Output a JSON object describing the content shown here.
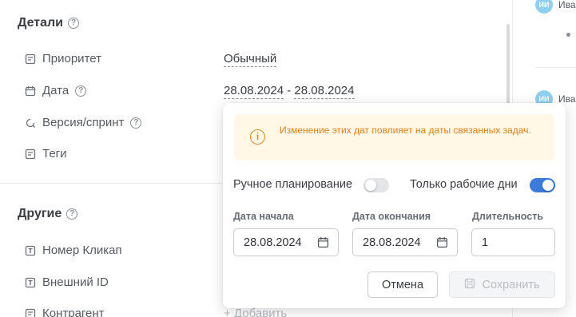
{
  "details": {
    "title": "Детали",
    "fields": [
      {
        "label": "Приоритет",
        "icon": "priority-icon",
        "value": "Обычный"
      },
      {
        "label": "Дата",
        "icon": "calendar-icon",
        "value_start": "28.08.2024",
        "value_sep": " - ",
        "value_end": "28.08.2024"
      },
      {
        "label": "Версия/спринт",
        "icon": "sprint-icon"
      },
      {
        "label": "Теги",
        "icon": "tag-icon"
      }
    ]
  },
  "other": {
    "title": "Другие",
    "fields": [
      {
        "label": "Номер Кликап",
        "icon": "text-field-icon"
      },
      {
        "label": "Внешний ID",
        "icon": "text-field-icon"
      },
      {
        "label": "Контрагент",
        "icon": "contractor-icon",
        "value": "+ Добавить"
      }
    ]
  },
  "activity": {
    "avatar_initials": "ИИ",
    "author_short": "Ива",
    "author_short_2": "Ива"
  },
  "popup": {
    "warning_text": "Изменение этих дат повлияет на даты связанных задач.",
    "manual_planning_label": "Ручное планирование",
    "manual_planning_on": false,
    "workdays_only_label": "Только рабочие дни",
    "workdays_only_on": true,
    "start_label": "Дата начала",
    "start_value": "28.08.2024",
    "end_label": "Дата окончания",
    "end_value": "28.08.2024",
    "duration_label": "Длительность",
    "duration_value": "1",
    "cancel_label": "Отмена",
    "save_label": "Сохранить"
  },
  "colors": {
    "accent": "#3b7ad9",
    "warning_bg": "#fff8e6",
    "warning_text": "#d98019",
    "avatar": "#8fd0ef"
  }
}
